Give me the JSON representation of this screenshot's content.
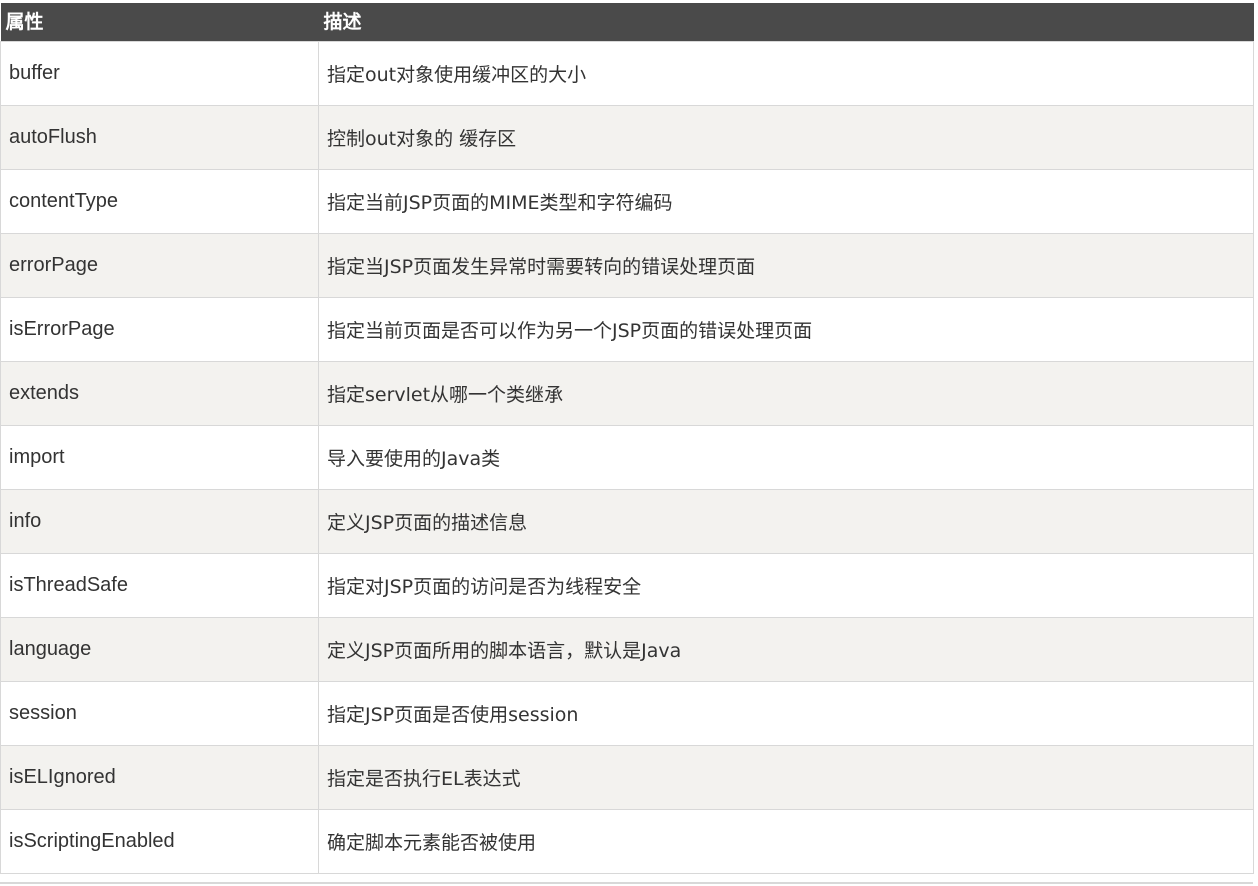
{
  "table": {
    "headers": [
      "属性",
      "描述"
    ],
    "rows": [
      {
        "attr": "buffer",
        "desc": "指定out对象使用缓冲区的大小"
      },
      {
        "attr": "autoFlush",
        "desc": "控制out对象的 缓存区"
      },
      {
        "attr": "contentType",
        "desc": "指定当前JSP页面的MIME类型和字符编码"
      },
      {
        "attr": "errorPage",
        "desc": "指定当JSP页面发生异常时需要转向的错误处理页面"
      },
      {
        "attr": "isErrorPage",
        "desc": "指定当前页面是否可以作为另一个JSP页面的错误处理页面"
      },
      {
        "attr": "extends",
        "desc": "指定servlet从哪一个类继承"
      },
      {
        "attr": "import",
        "desc": "导入要使用的Java类"
      },
      {
        "attr": "info",
        "desc": "定义JSP页面的描述信息"
      },
      {
        "attr": "isThreadSafe",
        "desc": "指定对JSP页面的访问是否为线程安全"
      },
      {
        "attr": "language",
        "desc": "定义JSP页面所用的脚本语言，默认是Java"
      },
      {
        "attr": "session",
        "desc": "指定JSP页面是否使用session"
      },
      {
        "attr": "isELIgnored",
        "desc": "指定是否执行EL表达式"
      },
      {
        "attr": "isScriptingEnabled",
        "desc": "确定脚本元素能否被使用"
      }
    ]
  },
  "colors": {
    "header_bg": "#4a4a4a",
    "header_text": "#ffffff",
    "row_alt_bg": "#f3f2ef",
    "border": "#d8d8d8",
    "cell_text": "#333333"
  }
}
